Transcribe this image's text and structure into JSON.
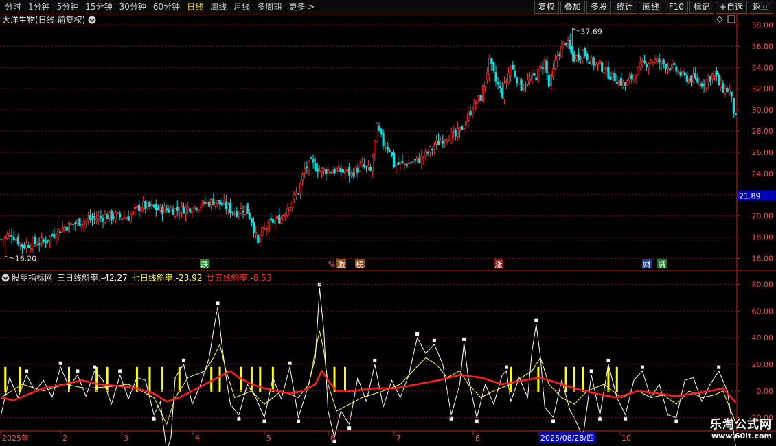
{
  "toolbar": {
    "periods": [
      "分时",
      "1分钟",
      "5分钟",
      "15分钟",
      "30分钟",
      "60分钟",
      "日线",
      "周线",
      "月线",
      "多周期",
      "更多 >"
    ],
    "active_period": "日线",
    "buttons": [
      "复权",
      "叠加",
      "多股",
      "统计",
      "画线",
      "F10",
      "标记",
      "+自选",
      "返回"
    ]
  },
  "main_chart": {
    "title": "大洋生物(日线,前复权)",
    "y_ticks": [
      "38.00",
      "36.00",
      "34.00",
      "32.00",
      "30.00",
      "28.00",
      "26.00",
      "24.00",
      "22.00",
      "20.00",
      "18.00",
      "16.00"
    ],
    "current_price_tag": "21.89",
    "high_label": "37.69",
    "low_label": "16.20",
    "event_markers": [
      {
        "label": "跌",
        "bg": "#1a8a2a"
      },
      {
        "label": "%",
        "bg": "#000000"
      },
      {
        "label": "激",
        "bg": "#8a4a1a"
      },
      {
        "label": "榜",
        "bg": "#8a4a1a"
      },
      {
        "label": "涨",
        "bg": "#8a1a1a"
      },
      {
        "label": "财",
        "bg": "#1a3a8a"
      },
      {
        "label": "减",
        "bg": "#1a7a2a"
      }
    ]
  },
  "indicator": {
    "title": "股朋指标网",
    "line1_label": "三日线斜率:",
    "line1_value": "-42.27",
    "line2_label": "七日线斜率:",
    "line2_value": "-23.92",
    "line3_label": "廿五线斜率:",
    "line3_value": "-8.53",
    "y_ticks": [
      "80.00",
      "60.00",
      "40.00",
      "20.00",
      "0.00",
      "-20.00"
    ]
  },
  "x_axis": {
    "labels": [
      "2025年",
      "2",
      "3",
      "4",
      "5",
      "6",
      "7",
      "8",
      "2025/08/28/四",
      "10"
    ]
  },
  "logo": {
    "name": "乐淘公式网",
    "url": "www.60lt.com"
  },
  "colors": {
    "up": "#ff3232",
    "down": "#00e4e4",
    "line1": "#ffffff",
    "line2": "#ffff66",
    "line3": "#ff2020",
    "bar": "#ffff00",
    "grid": "#8a1010",
    "axis": "#cc2222"
  },
  "chart_data": [
    {
      "type": "candlestick",
      "title": "大洋生物(日线,前复权)",
      "ylim": [
        15,
        39
      ],
      "annotations": {
        "high": 37.69,
        "low": 16.2,
        "current_price": 21.89
      },
      "close_path": [
        [
          0,
          17.8
        ],
        [
          5,
          18.3
        ],
        [
          10,
          17.2
        ],
        [
          20,
          17.6
        ],
        [
          30,
          19.0
        ],
        [
          40,
          19.6
        ],
        [
          50,
          20.0
        ],
        [
          60,
          19.9
        ],
        [
          66,
          21.0
        ],
        [
          75,
          20.6
        ],
        [
          85,
          20.6
        ],
        [
          95,
          21.1
        ],
        [
          100,
          21.4
        ],
        [
          105,
          21.0
        ],
        [
          110,
          20.3
        ],
        [
          115,
          20.8
        ],
        [
          118,
          19.6
        ],
        [
          121,
          17.3
        ],
        [
          123,
          18.5
        ],
        [
          128,
          19.5
        ],
        [
          132,
          19.8
        ],
        [
          136,
          21.2
        ],
        [
          140,
          22.3
        ],
        [
          143,
          24.4
        ],
        [
          146,
          25.0
        ],
        [
          150,
          24.3
        ],
        [
          158,
          24.3
        ],
        [
          165,
          24.0
        ],
        [
          170,
          24.7
        ],
        [
          174,
          24.2
        ],
        [
          177,
          28.3
        ],
        [
          180,
          26.8
        ],
        [
          183,
          26.4
        ],
        [
          185,
          24.8
        ],
        [
          192,
          25.0
        ],
        [
          198,
          25.4
        ],
        [
          204,
          26.6
        ],
        [
          210,
          27.6
        ],
        [
          214,
          27.5
        ],
        [
          218,
          28.6
        ],
        [
          222,
          30.3
        ],
        [
          226,
          31.2
        ],
        [
          230,
          34.5
        ],
        [
          233,
          32.7
        ],
        [
          236,
          31.5
        ],
        [
          240,
          34.1
        ],
        [
          245,
          32.2
        ],
        [
          252,
          33.2
        ],
        [
          256,
          34.6
        ],
        [
          258,
          32.2
        ],
        [
          262,
          35.1
        ],
        [
          266,
          36.5
        ],
        [
          270,
          34.8
        ],
        [
          274,
          35.5
        ],
        [
          278,
          34.5
        ],
        [
          282,
          34.2
        ],
        [
          286,
          33.4
        ],
        [
          290,
          32.9
        ],
        [
          294,
          32.3
        ],
        [
          298,
          33.3
        ],
        [
          302,
          34.2
        ],
        [
          306,
          34.7
        ],
        [
          310,
          34.5
        ],
        [
          314,
          34.2
        ],
        [
          318,
          33.7
        ],
        [
          322,
          33.0
        ],
        [
          326,
          32.9
        ],
        [
          330,
          32.5
        ],
        [
          334,
          33.1
        ],
        [
          336,
          33.5
        ],
        [
          338,
          32.4
        ],
        [
          340,
          32.0
        ],
        [
          343,
          31.8
        ],
        [
          346,
          29.1
        ]
      ]
    },
    {
      "type": "line",
      "series": [
        {
          "name": "三日线斜率",
          "last": -42.27,
          "points": [
            [
              0,
              -18
            ],
            [
              4,
              10
            ],
            [
              8,
              -5
            ],
            [
              12,
              12
            ],
            [
              16,
              0
            ],
            [
              20,
              8
            ],
            [
              24,
              -5
            ],
            [
              28,
              18
            ],
            [
              32,
              3
            ],
            [
              36,
              12
            ],
            [
              40,
              -4
            ],
            [
              44,
              15
            ],
            [
              48,
              8
            ],
            [
              52,
              -10
            ],
            [
              56,
              12
            ],
            [
              60,
              -6
            ],
            [
              64,
              10
            ],
            [
              68,
              8
            ],
            [
              72,
              -18
            ],
            [
              75,
              -8
            ],
            [
              78,
              -45
            ],
            [
              80,
              -35
            ],
            [
              82,
              10
            ],
            [
              86,
              20
            ],
            [
              90,
              -10
            ],
            [
              94,
              5
            ],
            [
              98,
              25
            ],
            [
              100,
              45
            ],
            [
              102,
              63
            ],
            [
              104,
              35
            ],
            [
              106,
              10
            ],
            [
              108,
              -10
            ],
            [
              112,
              -18
            ],
            [
              116,
              5
            ],
            [
              120,
              -5
            ],
            [
              124,
              -20
            ],
            [
              128,
              10
            ],
            [
              132,
              -6
            ],
            [
              136,
              18
            ],
            [
              140,
              -20
            ],
            [
              144,
              0
            ],
            [
              148,
              25
            ],
            [
              150,
              77
            ],
            [
              152,
              45
            ],
            [
              154,
              -15
            ],
            [
              157,
              -35
            ],
            [
              160,
              -15
            ],
            [
              164,
              -25
            ],
            [
              168,
              10
            ],
            [
              172,
              -8
            ],
            [
              176,
              20
            ],
            [
              180,
              -12
            ],
            [
              184,
              8
            ],
            [
              188,
              -5
            ],
            [
              192,
              12
            ],
            [
              196,
              40
            ],
            [
              200,
              28
            ],
            [
              204,
              35
            ],
            [
              208,
              20
            ],
            [
              212,
              -18
            ],
            [
              216,
              5
            ],
            [
              218,
              36
            ],
            [
              220,
              10
            ],
            [
              224,
              -20
            ],
            [
              228,
              5
            ],
            [
              232,
              -10
            ],
            [
              236,
              12
            ],
            [
              238,
              15
            ],
            [
              240,
              -8
            ],
            [
              244,
              10
            ],
            [
              248,
              -5
            ],
            [
              250,
              30
            ],
            [
              252,
              50
            ],
            [
              254,
              25
            ],
            [
              256,
              -12
            ],
            [
              260,
              -20
            ],
            [
              264,
              8
            ],
            [
              268,
              -15
            ],
            [
              270,
              -20
            ],
            [
              274,
              -35
            ],
            [
              278,
              12
            ],
            [
              282,
              -18
            ],
            [
              286,
              20
            ],
            [
              290,
              -5
            ],
            [
              294,
              -18
            ],
            [
              298,
              8
            ],
            [
              302,
              15
            ],
            [
              306,
              -5
            ],
            [
              310,
              5
            ],
            [
              314,
              -18
            ],
            [
              318,
              -20
            ],
            [
              322,
              8
            ],
            [
              326,
              10
            ],
            [
              330,
              -8
            ],
            [
              334,
              5
            ],
            [
              338,
              15
            ],
            [
              342,
              0
            ],
            [
              346,
              -42
            ]
          ]
        },
        {
          "name": "七日线斜率",
          "last": -23.92,
          "points": [
            [
              0,
              -5
            ],
            [
              10,
              5
            ],
            [
              20,
              0
            ],
            [
              30,
              5
            ],
            [
              40,
              2
            ],
            [
              50,
              3
            ],
            [
              60,
              5
            ],
            [
              66,
              0
            ],
            [
              72,
              -5
            ],
            [
              78,
              -25
            ],
            [
              82,
              -5
            ],
            [
              88,
              10
            ],
            [
              96,
              15
            ],
            [
              100,
              25
            ],
            [
              103,
              35
            ],
            [
              106,
              15
            ],
            [
              110,
              -5
            ],
            [
              118,
              0
            ],
            [
              124,
              -10
            ],
            [
              132,
              0
            ],
            [
              140,
              -5
            ],
            [
              145,
              5
            ],
            [
              148,
              30
            ],
            [
              150,
              45
            ],
            [
              152,
              30
            ],
            [
              154,
              5
            ],
            [
              158,
              -15
            ],
            [
              164,
              -10
            ],
            [
              170,
              -5
            ],
            [
              180,
              0
            ],
            [
              188,
              5
            ],
            [
              194,
              15
            ],
            [
              200,
              25
            ],
            [
              205,
              20
            ],
            [
              210,
              10
            ],
            [
              216,
              15
            ],
            [
              220,
              5
            ],
            [
              226,
              -5
            ],
            [
              232,
              0
            ],
            [
              240,
              5
            ],
            [
              250,
              15
            ],
            [
              254,
              25
            ],
            [
              258,
              5
            ],
            [
              264,
              -5
            ],
            [
              270,
              -10
            ],
            [
              276,
              0
            ],
            [
              284,
              5
            ],
            [
              292,
              -5
            ],
            [
              300,
              0
            ],
            [
              306,
              -5
            ],
            [
              312,
              -3
            ],
            [
              318,
              -10
            ],
            [
              324,
              0
            ],
            [
              330,
              -5
            ],
            [
              336,
              -3
            ],
            [
              340,
              0
            ],
            [
              346,
              -24
            ]
          ]
        },
        {
          "name": "廿五线斜率",
          "last": -8.53,
          "points": [
            [
              0,
              -5
            ],
            [
              6,
              -7
            ],
            [
              12,
              -3
            ],
            [
              20,
              2
            ],
            [
              30,
              5
            ],
            [
              38,
              8
            ],
            [
              46,
              5
            ],
            [
              54,
              4
            ],
            [
              64,
              2
            ],
            [
              72,
              -2
            ],
            [
              78,
              -8
            ],
            [
              84,
              -5
            ],
            [
              90,
              0
            ],
            [
              96,
              5
            ],
            [
              102,
              10
            ],
            [
              108,
              15
            ],
            [
              112,
              10
            ],
            [
              118,
              5
            ],
            [
              124,
              2
            ],
            [
              130,
              0
            ],
            [
              136,
              -2
            ],
            [
              142,
              0
            ],
            [
              148,
              5
            ],
            [
              151,
              15
            ],
            [
              154,
              8
            ],
            [
              158,
              0
            ],
            [
              166,
              0
            ],
            [
              176,
              2
            ],
            [
              186,
              2
            ],
            [
              196,
              5
            ],
            [
              206,
              8
            ],
            [
              216,
              12
            ],
            [
              226,
              10
            ],
            [
              236,
              5
            ],
            [
              246,
              8
            ],
            [
              254,
              10
            ],
            [
              262,
              6
            ],
            [
              270,
              2
            ],
            [
              280,
              -2
            ],
            [
              290,
              -5
            ],
            [
              300,
              0
            ],
            [
              310,
              -2
            ],
            [
              318,
              -4
            ],
            [
              326,
              -2
            ],
            [
              334,
              0
            ],
            [
              340,
              2
            ],
            [
              346,
              -9
            ]
          ]
        }
      ],
      "signal_bars_x": [
        2,
        9,
        32,
        45,
        50,
        64,
        70,
        76,
        84,
        99,
        103,
        113,
        118,
        122,
        128,
        157,
        162,
        240,
        253,
        266,
        270,
        274,
        286,
        290
      ],
      "ylim": [
        -30,
        90
      ]
    }
  ]
}
